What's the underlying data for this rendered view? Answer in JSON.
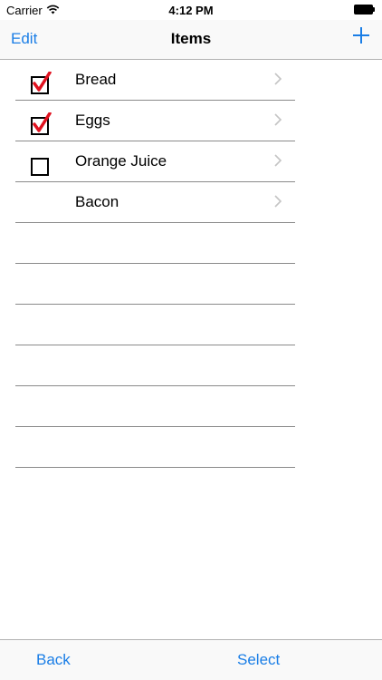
{
  "status_bar": {
    "carrier": "Carrier",
    "time": "4:12 PM",
    "wifi_icon": "wifi-icon",
    "battery_icon": "battery-icon"
  },
  "nav": {
    "left_label": "Edit",
    "title": "Items",
    "right_icon": "plus-icon"
  },
  "items": [
    {
      "label": "Bread",
      "checkbox": "checked"
    },
    {
      "label": "Eggs",
      "checkbox": "checked"
    },
    {
      "label": "Orange Juice",
      "checkbox": "unchecked"
    },
    {
      "label": "Bacon",
      "checkbox": "none"
    }
  ],
  "toolbar": {
    "back_label": "Back",
    "select_label": "Select"
  },
  "colors": {
    "accent": "#1a7ee6",
    "checkmark": "#e0121f",
    "separator": "#8a8a8a"
  }
}
